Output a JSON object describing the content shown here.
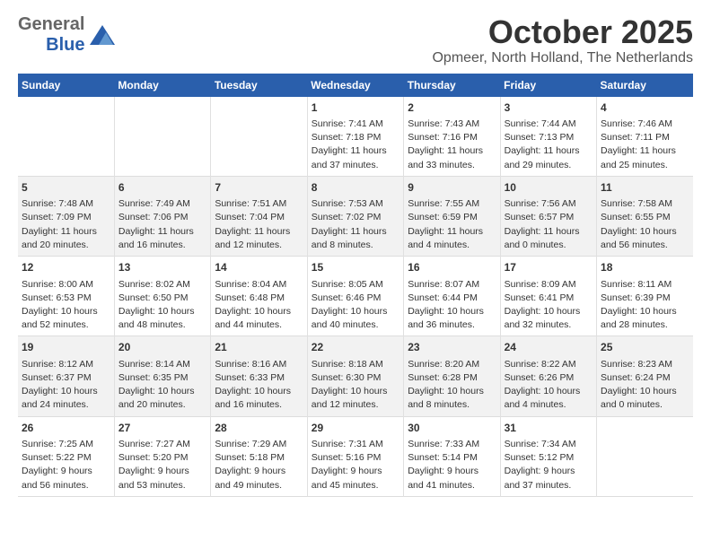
{
  "header": {
    "logo_general": "General",
    "logo_blue": "Blue",
    "month": "October 2025",
    "location": "Opmeer, North Holland, The Netherlands"
  },
  "days_of_week": [
    "Sunday",
    "Monday",
    "Tuesday",
    "Wednesday",
    "Thursday",
    "Friday",
    "Saturday"
  ],
  "weeks": [
    [
      {
        "day": "",
        "info": ""
      },
      {
        "day": "",
        "info": ""
      },
      {
        "day": "",
        "info": ""
      },
      {
        "day": "1",
        "info": "Sunrise: 7:41 AM\nSunset: 7:18 PM\nDaylight: 11 hours\nand 37 minutes."
      },
      {
        "day": "2",
        "info": "Sunrise: 7:43 AM\nSunset: 7:16 PM\nDaylight: 11 hours\nand 33 minutes."
      },
      {
        "day": "3",
        "info": "Sunrise: 7:44 AM\nSunset: 7:13 PM\nDaylight: 11 hours\nand 29 minutes."
      },
      {
        "day": "4",
        "info": "Sunrise: 7:46 AM\nSunset: 7:11 PM\nDaylight: 11 hours\nand 25 minutes."
      }
    ],
    [
      {
        "day": "5",
        "info": "Sunrise: 7:48 AM\nSunset: 7:09 PM\nDaylight: 11 hours\nand 20 minutes."
      },
      {
        "day": "6",
        "info": "Sunrise: 7:49 AM\nSunset: 7:06 PM\nDaylight: 11 hours\nand 16 minutes."
      },
      {
        "day": "7",
        "info": "Sunrise: 7:51 AM\nSunset: 7:04 PM\nDaylight: 11 hours\nand 12 minutes."
      },
      {
        "day": "8",
        "info": "Sunrise: 7:53 AM\nSunset: 7:02 PM\nDaylight: 11 hours\nand 8 minutes."
      },
      {
        "day": "9",
        "info": "Sunrise: 7:55 AM\nSunset: 6:59 PM\nDaylight: 11 hours\nand 4 minutes."
      },
      {
        "day": "10",
        "info": "Sunrise: 7:56 AM\nSunset: 6:57 PM\nDaylight: 11 hours\nand 0 minutes."
      },
      {
        "day": "11",
        "info": "Sunrise: 7:58 AM\nSunset: 6:55 PM\nDaylight: 10 hours\nand 56 minutes."
      }
    ],
    [
      {
        "day": "12",
        "info": "Sunrise: 8:00 AM\nSunset: 6:53 PM\nDaylight: 10 hours\nand 52 minutes."
      },
      {
        "day": "13",
        "info": "Sunrise: 8:02 AM\nSunset: 6:50 PM\nDaylight: 10 hours\nand 48 minutes."
      },
      {
        "day": "14",
        "info": "Sunrise: 8:04 AM\nSunset: 6:48 PM\nDaylight: 10 hours\nand 44 minutes."
      },
      {
        "day": "15",
        "info": "Sunrise: 8:05 AM\nSunset: 6:46 PM\nDaylight: 10 hours\nand 40 minutes."
      },
      {
        "day": "16",
        "info": "Sunrise: 8:07 AM\nSunset: 6:44 PM\nDaylight: 10 hours\nand 36 minutes."
      },
      {
        "day": "17",
        "info": "Sunrise: 8:09 AM\nSunset: 6:41 PM\nDaylight: 10 hours\nand 32 minutes."
      },
      {
        "day": "18",
        "info": "Sunrise: 8:11 AM\nSunset: 6:39 PM\nDaylight: 10 hours\nand 28 minutes."
      }
    ],
    [
      {
        "day": "19",
        "info": "Sunrise: 8:12 AM\nSunset: 6:37 PM\nDaylight: 10 hours\nand 24 minutes."
      },
      {
        "day": "20",
        "info": "Sunrise: 8:14 AM\nSunset: 6:35 PM\nDaylight: 10 hours\nand 20 minutes."
      },
      {
        "day": "21",
        "info": "Sunrise: 8:16 AM\nSunset: 6:33 PM\nDaylight: 10 hours\nand 16 minutes."
      },
      {
        "day": "22",
        "info": "Sunrise: 8:18 AM\nSunset: 6:30 PM\nDaylight: 10 hours\nand 12 minutes."
      },
      {
        "day": "23",
        "info": "Sunrise: 8:20 AM\nSunset: 6:28 PM\nDaylight: 10 hours\nand 8 minutes."
      },
      {
        "day": "24",
        "info": "Sunrise: 8:22 AM\nSunset: 6:26 PM\nDaylight: 10 hours\nand 4 minutes."
      },
      {
        "day": "25",
        "info": "Sunrise: 8:23 AM\nSunset: 6:24 PM\nDaylight: 10 hours\nand 0 minutes."
      }
    ],
    [
      {
        "day": "26",
        "info": "Sunrise: 7:25 AM\nSunset: 5:22 PM\nDaylight: 9 hours\nand 56 minutes."
      },
      {
        "day": "27",
        "info": "Sunrise: 7:27 AM\nSunset: 5:20 PM\nDaylight: 9 hours\nand 53 minutes."
      },
      {
        "day": "28",
        "info": "Sunrise: 7:29 AM\nSunset: 5:18 PM\nDaylight: 9 hours\nand 49 minutes."
      },
      {
        "day": "29",
        "info": "Sunrise: 7:31 AM\nSunset: 5:16 PM\nDaylight: 9 hours\nand 45 minutes."
      },
      {
        "day": "30",
        "info": "Sunrise: 7:33 AM\nSunset: 5:14 PM\nDaylight: 9 hours\nand 41 minutes."
      },
      {
        "day": "31",
        "info": "Sunrise: 7:34 AM\nSunset: 5:12 PM\nDaylight: 9 hours\nand 37 minutes."
      },
      {
        "day": "",
        "info": ""
      }
    ]
  ]
}
